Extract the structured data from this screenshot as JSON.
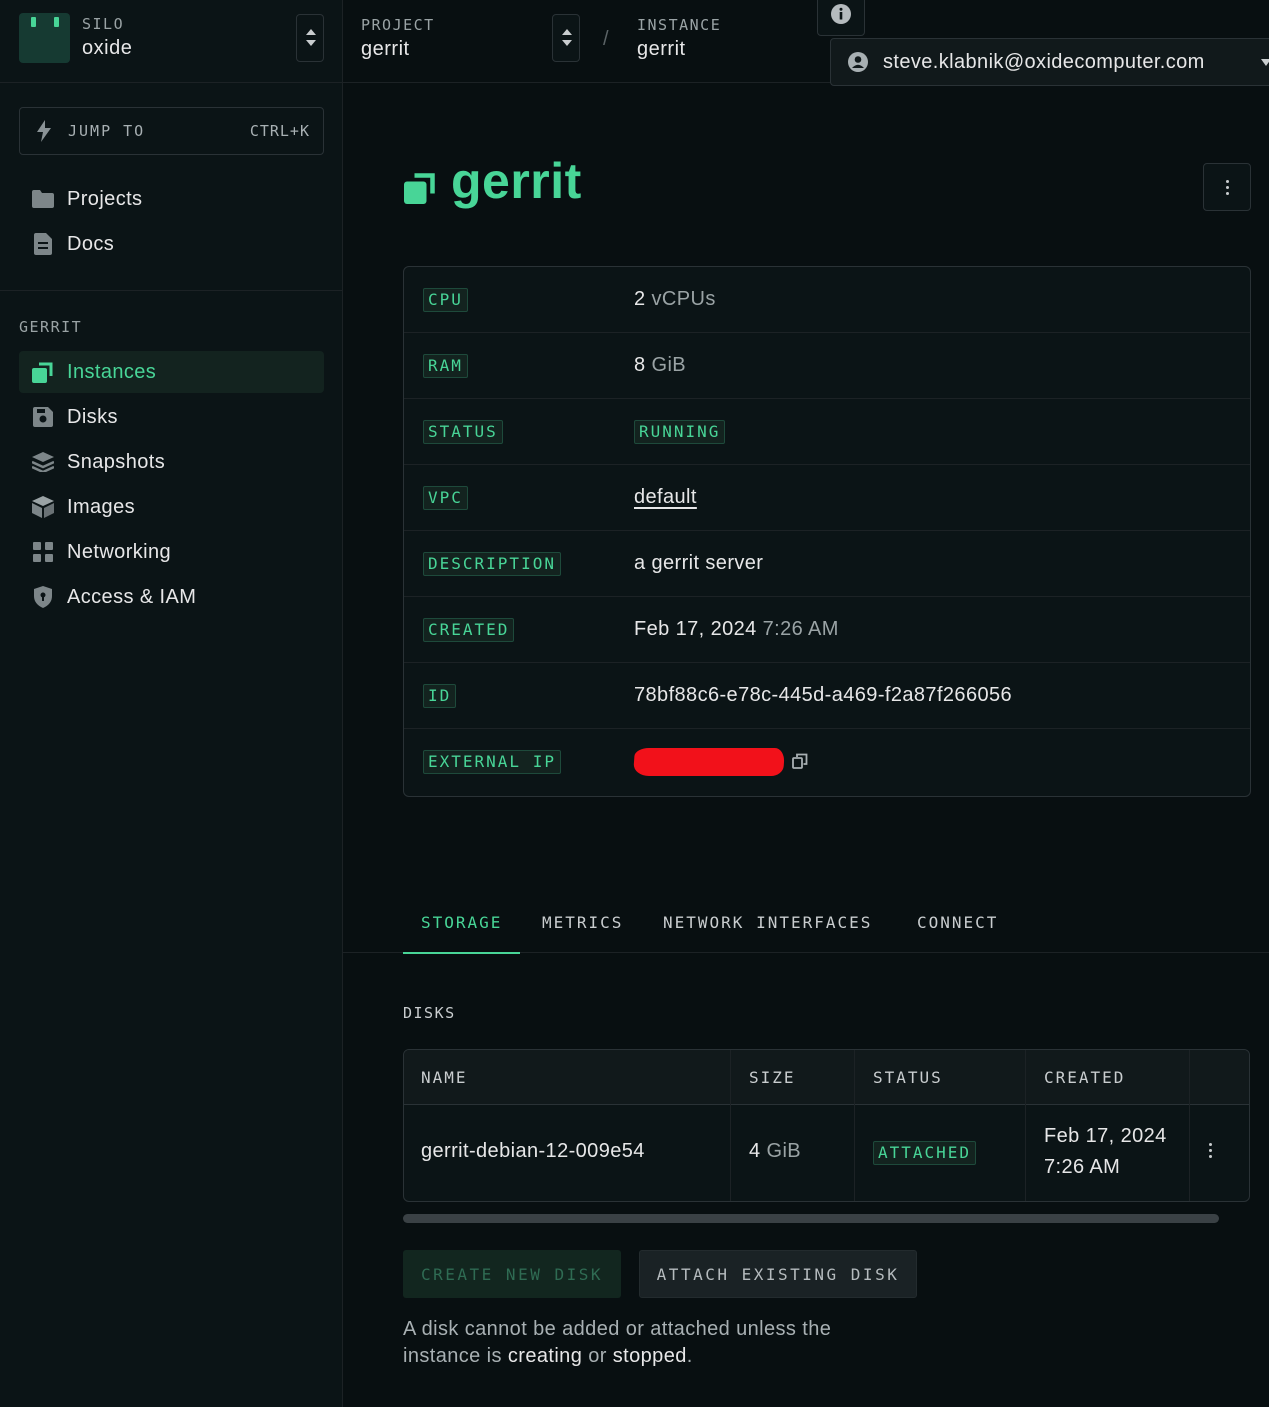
{
  "silo": {
    "eyebrow": "SILO",
    "name": "oxide"
  },
  "jump": {
    "label": "JUMP TO",
    "shortcut": "CTRL+K",
    "icon": "lightning-icon"
  },
  "nav_top": [
    {
      "label": "Projects",
      "icon": "folder-icon"
    },
    {
      "label": "Docs",
      "icon": "document-icon"
    }
  ],
  "project_section": {
    "label": "GERRIT"
  },
  "nav_project": [
    {
      "label": "Instances",
      "icon": "instances-icon",
      "active": true
    },
    {
      "label": "Disks",
      "icon": "disk-icon"
    },
    {
      "label": "Snapshots",
      "icon": "snapshots-icon"
    },
    {
      "label": "Images",
      "icon": "images-icon"
    },
    {
      "label": "Networking",
      "icon": "networking-icon"
    },
    {
      "label": "Access & IAM",
      "icon": "shield-icon"
    }
  ],
  "breadcrumb": {
    "project": {
      "eyebrow": "PROJECT",
      "value": "gerrit"
    },
    "separator": "/",
    "instance": {
      "eyebrow": "INSTANCE",
      "value": "gerrit"
    }
  },
  "user": {
    "email": "steve.klabnik@oxidecomputer.com"
  },
  "page": {
    "title": "gerrit",
    "title_icon": "instances-icon"
  },
  "properties": {
    "cpu": {
      "key": "CPU",
      "value": "2",
      "unit": "vCPUs"
    },
    "ram": {
      "key": "RAM",
      "value": "8",
      "unit": "GiB"
    },
    "status": {
      "key": "STATUS",
      "value": "RUNNING"
    },
    "vpc": {
      "key": "VPC",
      "value": "default"
    },
    "description": {
      "key": "DESCRIPTION",
      "value": "a gerrit server"
    },
    "created": {
      "key": "CREATED",
      "date": "Feb 17, 2024",
      "time": "7:26 AM"
    },
    "id": {
      "key": "ID",
      "value": "78bf88c6-e78c-445d-a469-f2a87f266056"
    },
    "external_ip": {
      "key": "EXTERNAL IP",
      "value_redacted": true
    }
  },
  "tabs": [
    {
      "label": "STORAGE",
      "active": true
    },
    {
      "label": "METRICS"
    },
    {
      "label": "NETWORK INTERFACES"
    },
    {
      "label": "CONNECT"
    }
  ],
  "disks": {
    "section_label": "DISKS",
    "columns": [
      "NAME",
      "SIZE",
      "STATUS",
      "CREATED"
    ],
    "rows": [
      {
        "name": "gerrit-debian-12-009e54",
        "size_value": "4",
        "size_unit": "GiB",
        "status": "ATTACHED",
        "created_date": "Feb 17, 2024",
        "created_time": "7:26 AM"
      }
    ]
  },
  "actions": {
    "create": "CREATE NEW DISK",
    "attach": "ATTACH EXISTING DISK"
  },
  "note": {
    "prefix": "A disk cannot be added or attached unless the instance is",
    "state1": "creating",
    "joiner": "or",
    "state2": "stopped",
    "suffix": "."
  },
  "colors": {
    "accent": "#48d597",
    "background": "#080f11",
    "redaction": "#f2111a"
  }
}
